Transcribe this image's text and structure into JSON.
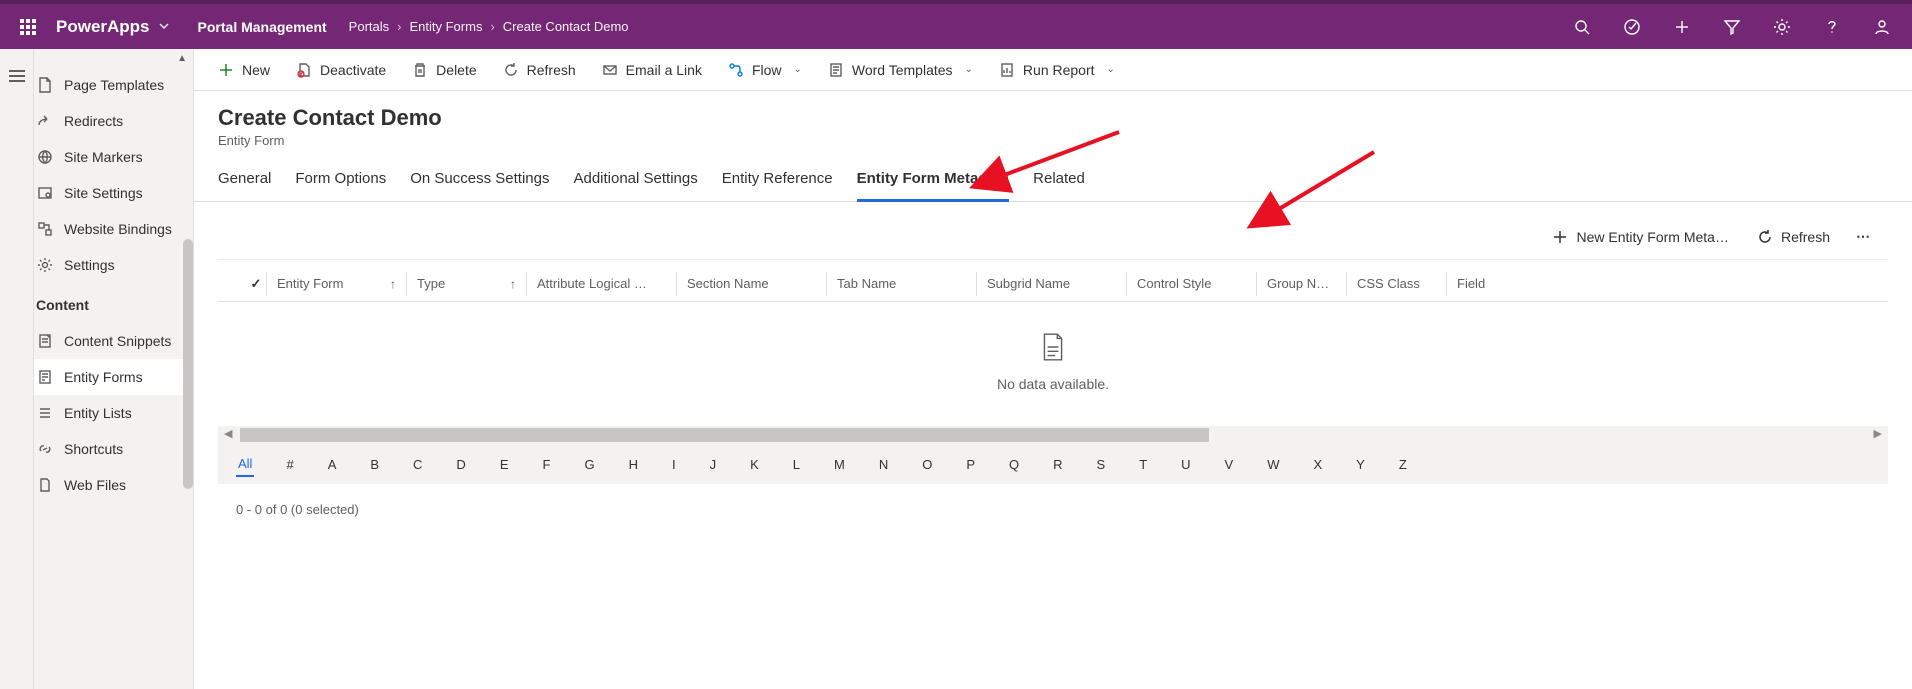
{
  "topbar": {
    "brand": "PowerApps",
    "app_area": "Portal Management",
    "breadcrumbs": [
      "Portals",
      "Entity Forms",
      "Create Contact Demo"
    ]
  },
  "sidebar": {
    "items_top": [
      {
        "icon": "page",
        "label": "Page Templates"
      },
      {
        "icon": "redirect",
        "label": "Redirects"
      },
      {
        "icon": "globe",
        "label": "Site Markers"
      },
      {
        "icon": "settings-page",
        "label": "Site Settings"
      },
      {
        "icon": "bindings",
        "label": "Website Bindings"
      },
      {
        "icon": "gear",
        "label": "Settings"
      }
    ],
    "section_label": "Content",
    "items_content": [
      {
        "icon": "snippet",
        "label": "Content Snippets"
      },
      {
        "icon": "form",
        "label": "Entity Forms",
        "active": true
      },
      {
        "icon": "list",
        "label": "Entity Lists"
      },
      {
        "icon": "shortcut",
        "label": "Shortcuts"
      },
      {
        "icon": "file",
        "label": "Web Files"
      }
    ]
  },
  "commandbar": {
    "new": "New",
    "deactivate": "Deactivate",
    "delete": "Delete",
    "refresh": "Refresh",
    "email": "Email a Link",
    "flow": "Flow",
    "word": "Word Templates",
    "report": "Run Report"
  },
  "record": {
    "title": "Create Contact Demo",
    "subtitle": "Entity Form"
  },
  "tabs": [
    "General",
    "Form Options",
    "On Success Settings",
    "Additional Settings",
    "Entity Reference",
    "Entity Form Metadata",
    "Related"
  ],
  "active_tab": "Entity Form Metadata",
  "subgrid_cmd": {
    "new": "New Entity Form Meta…",
    "refresh": "Refresh"
  },
  "grid": {
    "columns": [
      "Entity Form",
      "Type",
      "Attribute Logical …",
      "Section Name",
      "Tab Name",
      "Subgrid Name",
      "Control Style",
      "Group N…",
      "CSS Class",
      "Field"
    ],
    "empty_text": "No data available.",
    "footer": "0 - 0 of 0 (0 selected)"
  },
  "alpha": [
    "All",
    "#",
    "A",
    "B",
    "C",
    "D",
    "E",
    "F",
    "G",
    "H",
    "I",
    "J",
    "K",
    "L",
    "M",
    "N",
    "O",
    "P",
    "Q",
    "R",
    "S",
    "T",
    "U",
    "V",
    "W",
    "X",
    "Y",
    "Z"
  ]
}
